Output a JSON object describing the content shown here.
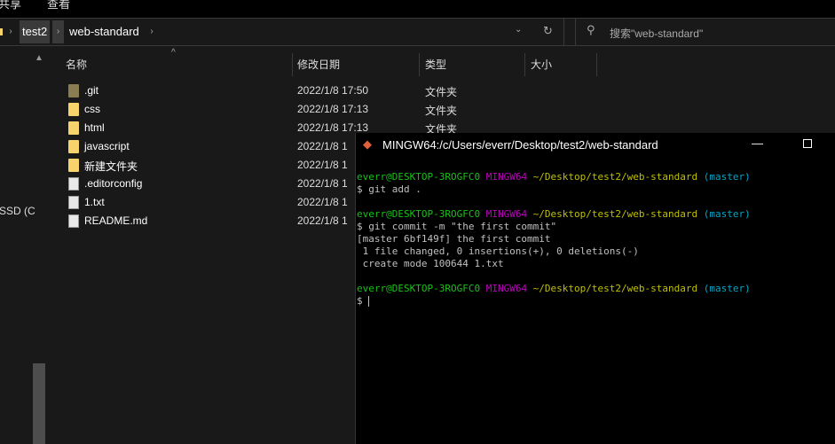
{
  "menubar": {
    "items": [
      "共享",
      "查看"
    ]
  },
  "address": {
    "crumbs": [
      "test2",
      "web-standard"
    ],
    "search_placeholder": "搜索\"web-standard\""
  },
  "nav": {
    "drive_label": "SSD (C"
  },
  "columns": [
    "名称",
    "修改日期",
    "类型",
    "大小"
  ],
  "files": [
    {
      "name": ".git",
      "date": "2022/1/8 17:50",
      "type": "文件夹",
      "icon": "folder-git-icon"
    },
    {
      "name": "css",
      "date": "2022/1/8 17:13",
      "type": "文件夹",
      "icon": "folder-icon"
    },
    {
      "name": "html",
      "date": "2022/1/8 17:13",
      "type": "文件夹",
      "icon": "folder-icon"
    },
    {
      "name": "javascript",
      "date": "2022/1/8 1",
      "type": "",
      "icon": "folder-icon"
    },
    {
      "name": "新建文件夹",
      "date": "2022/1/8 1",
      "type": "",
      "icon": "folder-icon"
    },
    {
      "name": ".editorconfig",
      "date": "2022/1/8 1",
      "type": "",
      "icon": "config-file-icon"
    },
    {
      "name": "1.txt",
      "date": "2022/1/8 1",
      "type": "",
      "icon": "text-file-icon"
    },
    {
      "name": "README.md",
      "date": "2022/1/8 1",
      "type": "",
      "icon": "markdown-file-icon"
    }
  ],
  "terminal": {
    "title": "MINGW64:/c/Users/everr/Desktop/test2/web-standard",
    "prompt": {
      "user": "everr@DESKTOP-3ROGFC0",
      "sys": "MINGW64",
      "path": "~/Desktop/test2/web-standard",
      "branch": "(master)"
    },
    "cmd1": "$ git add .",
    "cmd2": "$ git commit -m \"the first commit\"",
    "out1": "[master 6bf149f] the first commit",
    "out2": " 1 file changed, 0 insertions(+), 0 deletions(-)",
    "out3": " create mode 100644 1.txt",
    "cmd3": "$ ",
    "colors": {
      "user": "#19c019",
      "sys": "#c000c0",
      "path": "#c0c000",
      "branch": "#00a8c8"
    }
  }
}
